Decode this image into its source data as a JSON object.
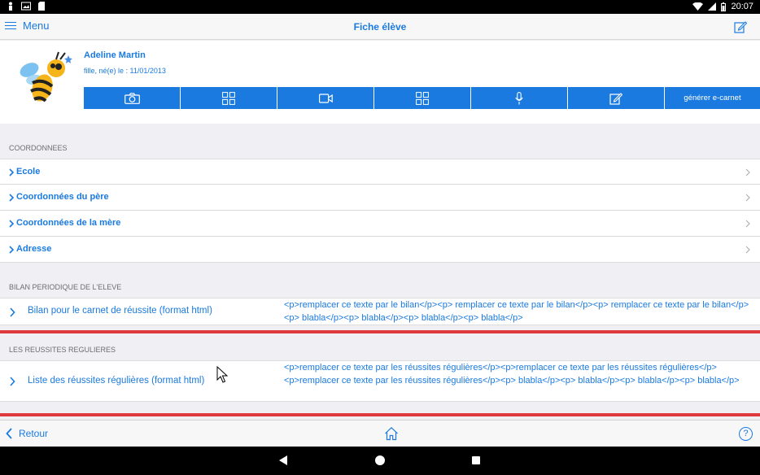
{
  "statusbar": {
    "time": "20:07"
  },
  "nav": {
    "menu_label": "Menu",
    "title": "Fiche élève"
  },
  "profile": {
    "name": "Adeline Martin",
    "info": "fille, né(e) le : 11/01/2013"
  },
  "actions": {
    "generate_label": "générer e-carnet"
  },
  "sections": {
    "coords": {
      "title": "COORDONNEES",
      "items": [
        {
          "label": "Ecole"
        },
        {
          "label": "Coordonnées du père"
        },
        {
          "label": "Coordonnées de la mère"
        },
        {
          "label": "Adresse"
        }
      ]
    },
    "bilan": {
      "title": "BILAN PERIODIQUE DE L'ELEVE",
      "label": "Bilan pour le carnet de réussite (format html)",
      "value": "<p>remplacer ce texte par le bilan</p><p> remplacer ce texte par le bilan</p><p> remplacer ce texte par le bilan</p><p> blabla</p><p> blabla</p><p> blabla</p><p> blabla</p>"
    },
    "reussites": {
      "title": "LES REUSSITES REGULIERES",
      "label": "Liste des réussites régulières (format html)",
      "value": "<p>remplacer ce texte par les réussites régulières</p><p>remplacer ce texte par les réussites régulières</p><p>remplacer ce texte par les réussites régulières</p><p> blabla</p><p> blabla</p><p> blabla</p><p> blabla</p>"
    }
  },
  "toolbar": {
    "back_label": "Retour",
    "help_label": "?"
  },
  "colors": {
    "accent": "#1a7ae0",
    "separator": "#e0393e",
    "background": "#efeff4"
  },
  "icons": [
    "camera-icon",
    "grid-icon",
    "video-icon",
    "grid-icon",
    "microphone-icon",
    "edit-icon"
  ]
}
